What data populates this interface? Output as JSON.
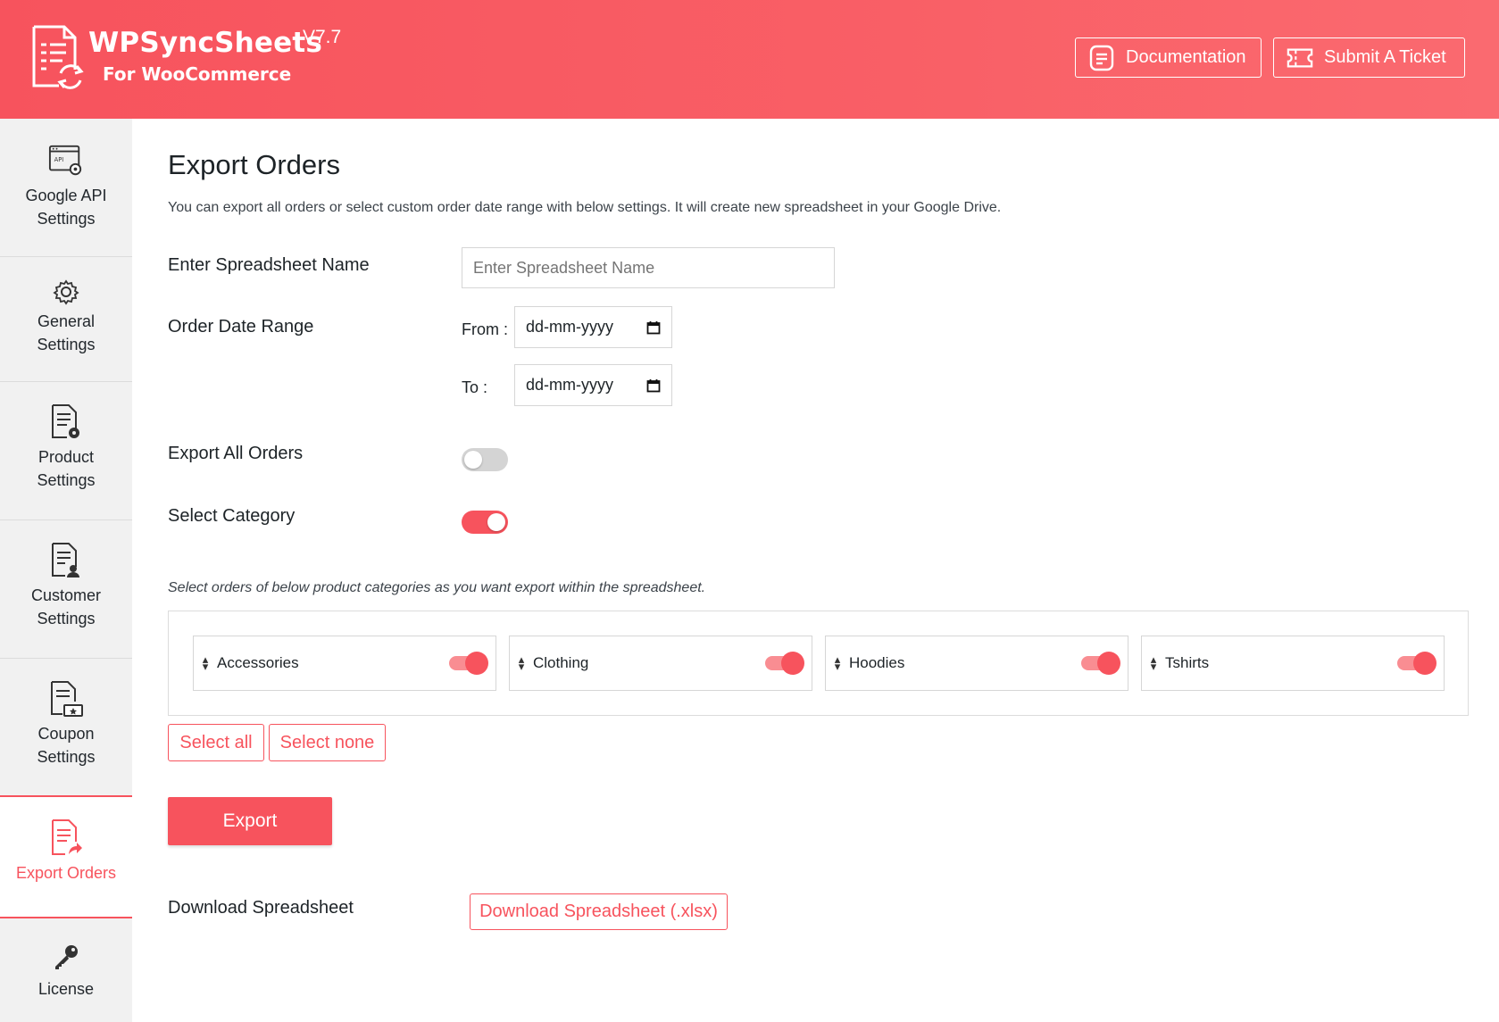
{
  "header": {
    "brand_title": "WPSyncSheets",
    "brand_subtitle": "For WooCommerce",
    "version": "V7.7",
    "documentation_label": "Documentation",
    "submit_ticket_label": "Submit A Ticket"
  },
  "sidebar": {
    "items": [
      {
        "line1": "Google API",
        "line2": "Settings",
        "icon": "api-settings-icon"
      },
      {
        "line1": "General",
        "line2": "Settings",
        "icon": "gear-icon"
      },
      {
        "line1": "Product",
        "line2": "Settings",
        "icon": "product-settings-icon"
      },
      {
        "line1": "Customer",
        "line2": "Settings",
        "icon": "customer-settings-icon"
      },
      {
        "line1": "Coupon",
        "line2": "Settings",
        "icon": "coupon-settings-icon"
      },
      {
        "line1": "Export Orders",
        "line2": "",
        "icon": "export-orders-icon",
        "active": true
      },
      {
        "line1": "License",
        "line2": "",
        "icon": "key-icon"
      }
    ]
  },
  "main": {
    "title": "Export Orders",
    "description": "You can export all orders or select custom order date range with below settings. It will create new spreadsheet in your Google Drive.",
    "spreadsheet_name": {
      "label": "Enter Spreadsheet Name",
      "placeholder": "Enter Spreadsheet Name",
      "value": ""
    },
    "date_range": {
      "label": "Order Date Range",
      "from_label": "From :",
      "to_label": "To :",
      "from_value": "dd-mm-yyyy",
      "to_value": "dd-mm-yyyy"
    },
    "export_all": {
      "label": "Export All Orders",
      "enabled": false
    },
    "select_category": {
      "label": "Select Category",
      "enabled": true
    },
    "category_note": "Select orders of below product categories as you want export within the spreadsheet.",
    "categories": [
      {
        "name": "Accessories",
        "enabled": true
      },
      {
        "name": "Clothing",
        "enabled": true
      },
      {
        "name": "Hoodies",
        "enabled": true
      },
      {
        "name": "Tshirts",
        "enabled": true
      }
    ],
    "select_all_label": "Select all",
    "select_none_label": "Select none",
    "export_label": "Export",
    "download": {
      "label": "Download Spreadsheet",
      "button_label": "Download Spreadsheet (.xlsx)"
    }
  },
  "colors": {
    "accent": "#f7535d",
    "sidebar_bg": "#f1f1f1",
    "toggle_off": "#d4d4d4"
  }
}
